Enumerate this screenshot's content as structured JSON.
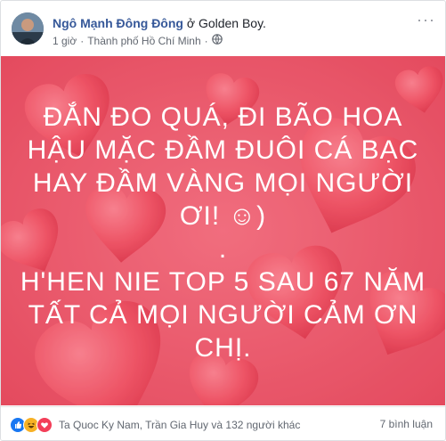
{
  "post": {
    "author": "Ngô Mạnh Đông Đông",
    "location_prefix": "ở",
    "location": "Golden Boy.",
    "time": "1 giờ",
    "place": "Thành phố Hồ Chí Minh",
    "privacy_icon": "globe-icon",
    "menu_icon": "more-horizontal-icon"
  },
  "image": {
    "background_color": "#e95a6c",
    "text_lines": [
      "ĐẮN ĐO QUÁ, ĐI BÃO HOA",
      "HẬU MẶC ĐẦM ĐUÔI CÁ BẠC",
      "HAY ĐẦM VÀNG MỌI NGƯỜI",
      "ƠI! ☺)",
      ".",
      "H'HEN NIE TOP 5 SAU 67 NĂM",
      "TẤT CẢ MỌI NGƯỜI CẢM ƠN",
      "CHỊ."
    ]
  },
  "footer": {
    "reaction_icons": [
      "like-icon",
      "haha-icon",
      "love-icon"
    ],
    "reactions_text": "Ta Quoc Ky Nam, Trần Gia Huy và 132 người khác",
    "comments_text": "7 bình luận"
  }
}
